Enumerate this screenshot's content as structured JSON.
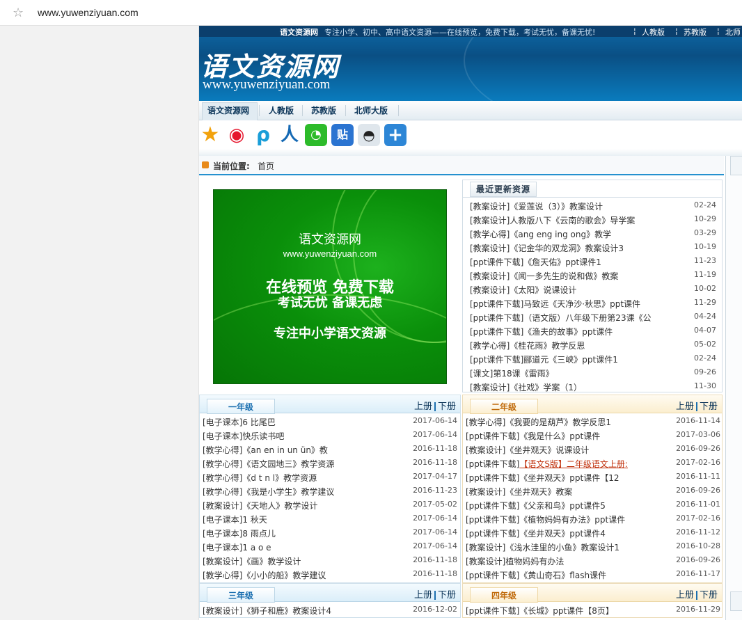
{
  "browser": {
    "url": "www.yuwenziyuan.com",
    "star_icon": "☆"
  },
  "topline": {
    "site_name": "语文资源网",
    "description": "专注小学、初中、高中语文资源——在线预览，免费下载，考试无忧，备课无忧!",
    "links": [
      "人教版",
      "苏教版",
      "北师"
    ]
  },
  "header": {
    "logo": "语文资源网",
    "url": "www.yuwenziyuan.com"
  },
  "nav": {
    "items": [
      "语文资源网",
      "人教版",
      "苏教版",
      "北师大版"
    ]
  },
  "share": {
    "icons": [
      "qzone-icon",
      "weibo-icon",
      "pengyou-icon",
      "renren-icon",
      "wechat-icon",
      "tieba-icon",
      "qq-icon",
      "more-icon"
    ]
  },
  "location": {
    "label": "当前位置:",
    "current": "首页"
  },
  "banner": {
    "line1": "语文资源网",
    "line2": "www.yuwenziyuan.com",
    "line3": "在线预览 免费下载",
    "line4": "考试无忧 备课无虑",
    "line5": "专注中小学语文资源"
  },
  "latest": {
    "title": "最近更新资源",
    "items": [
      {
        "t": "[教案设计]《爱莲说（3）》教案设计",
        "d": "02-24"
      },
      {
        "t": "[教案设计]人教版八下《云南的歌会》导学案",
        "d": "10-29"
      },
      {
        "t": "[教学心得]《ang eng ing ong》教学",
        "d": "03-29"
      },
      {
        "t": "[教案设计]《记金华的双龙洞》教案设计3",
        "d": "10-19"
      },
      {
        "t": "[ppt课件下载]《詹天佑》ppt课件1",
        "d": "11-23"
      },
      {
        "t": "[教案设计]《闻一多先生的说和做》教案",
        "d": "11-19"
      },
      {
        "t": "[教案设计]《太阳》说课设计",
        "d": "10-02"
      },
      {
        "t": "[ppt课件下载]马致远《天净沙·秋思》ppt课件",
        "d": "11-29"
      },
      {
        "t": "[ppt课件下载]（语文版）八年级下册第23课《公",
        "d": "04-24"
      },
      {
        "t": "[ppt课件下载]《渔夫的故事》ppt课件",
        "d": "04-07"
      },
      {
        "t": "[教学心得]《桂花雨》教学反思",
        "d": "05-02"
      },
      {
        "t": "[ppt课件下载]郦道元《三峡》ppt课件1",
        "d": "02-24"
      },
      {
        "t": "[课文]第18课《雷雨》",
        "d": "09-26"
      },
      {
        "t": "[教案设计]《社戏》学案（1）",
        "d": "11-30"
      }
    ]
  },
  "grade1": {
    "title": "一年级",
    "vol_up": "上册",
    "vol_down": "下册",
    "items": [
      {
        "t": "[电子课本]6 比尾巴",
        "d": "2017-06-14"
      },
      {
        "t": "[电子课本]快乐读书吧",
        "d": "2017-06-14"
      },
      {
        "t": "[教学心得]《an en in un ün》教",
        "d": "2016-11-18"
      },
      {
        "t": "[教学心得]《语文园地三》教学资源",
        "d": "2016-11-18"
      },
      {
        "t": "[教学心得]《d t n l》教学资源",
        "d": "2017-04-17"
      },
      {
        "t": "[教学心得]《我是小学生》教学建议",
        "d": "2016-11-23"
      },
      {
        "t": "[教案设计]《天地人》教学设计",
        "d": "2017-05-02"
      },
      {
        "t": "[电子课本]1 秋天",
        "d": "2017-06-14"
      },
      {
        "t": "[电子课本]8 雨点儿",
        "d": "2017-06-14"
      },
      {
        "t": "[电子课本]1 a o e",
        "d": "2017-06-14"
      },
      {
        "t": "[教案设计]《画》教学设计",
        "d": "2016-11-18"
      },
      {
        "t": "[教学心得]《小小的船》教学建议",
        "d": "2016-11-18"
      }
    ]
  },
  "grade2": {
    "title": "二年级",
    "vol_up": "上册",
    "vol_down": "下册",
    "items": [
      {
        "t": "[教学心得]《我要的是葫芦》教学反思1",
        "d": "2016-11-14"
      },
      {
        "t": "[ppt课件下载]《我是什么》ppt课件",
        "d": "2017-03-06"
      },
      {
        "t": "[教案设计]《坐井观天》说课设计",
        "d": "2016-09-26"
      },
      {
        "t": "[ppt课件下载]",
        "hl": "【语文S版】二年级语文上册:",
        "d": "2017-02-16"
      },
      {
        "t": "[ppt课件下载]《坐井观天》ppt课件【12",
        "d": "2016-11-11"
      },
      {
        "t": "[教案设计]《坐井观天》教案",
        "d": "2016-09-26"
      },
      {
        "t": "[ppt课件下载]《父亲和鸟》ppt课件5",
        "d": "2016-11-01"
      },
      {
        "t": "[ppt课件下载]《植物妈妈有办法》ppt课件",
        "d": "2017-02-16"
      },
      {
        "t": "[ppt课件下载]《坐井观天》ppt课件4",
        "d": "2016-11-12"
      },
      {
        "t": "[教案设计]《浅水洼里的小鱼》教案设计1",
        "d": "2016-10-28"
      },
      {
        "t": "[教案设计]植物妈妈有办法",
        "d": "2016-09-26"
      },
      {
        "t": "[ppt课件下载]《黄山奇石》flash课件",
        "d": "2016-11-17"
      }
    ]
  },
  "grade3": {
    "title": "三年级",
    "vol_up": "上册",
    "vol_down": "下册",
    "items": [
      {
        "t": "[教案设计]《狮子和鹿》教案设计4",
        "d": "2016-12-02"
      }
    ]
  },
  "grade4": {
    "title": "四年级",
    "vol_up": "上册",
    "vol_down": "下册",
    "items": [
      {
        "t": "[ppt课件下载]《长城》ppt课件【8页】",
        "d": "2016-11-29"
      }
    ]
  }
}
